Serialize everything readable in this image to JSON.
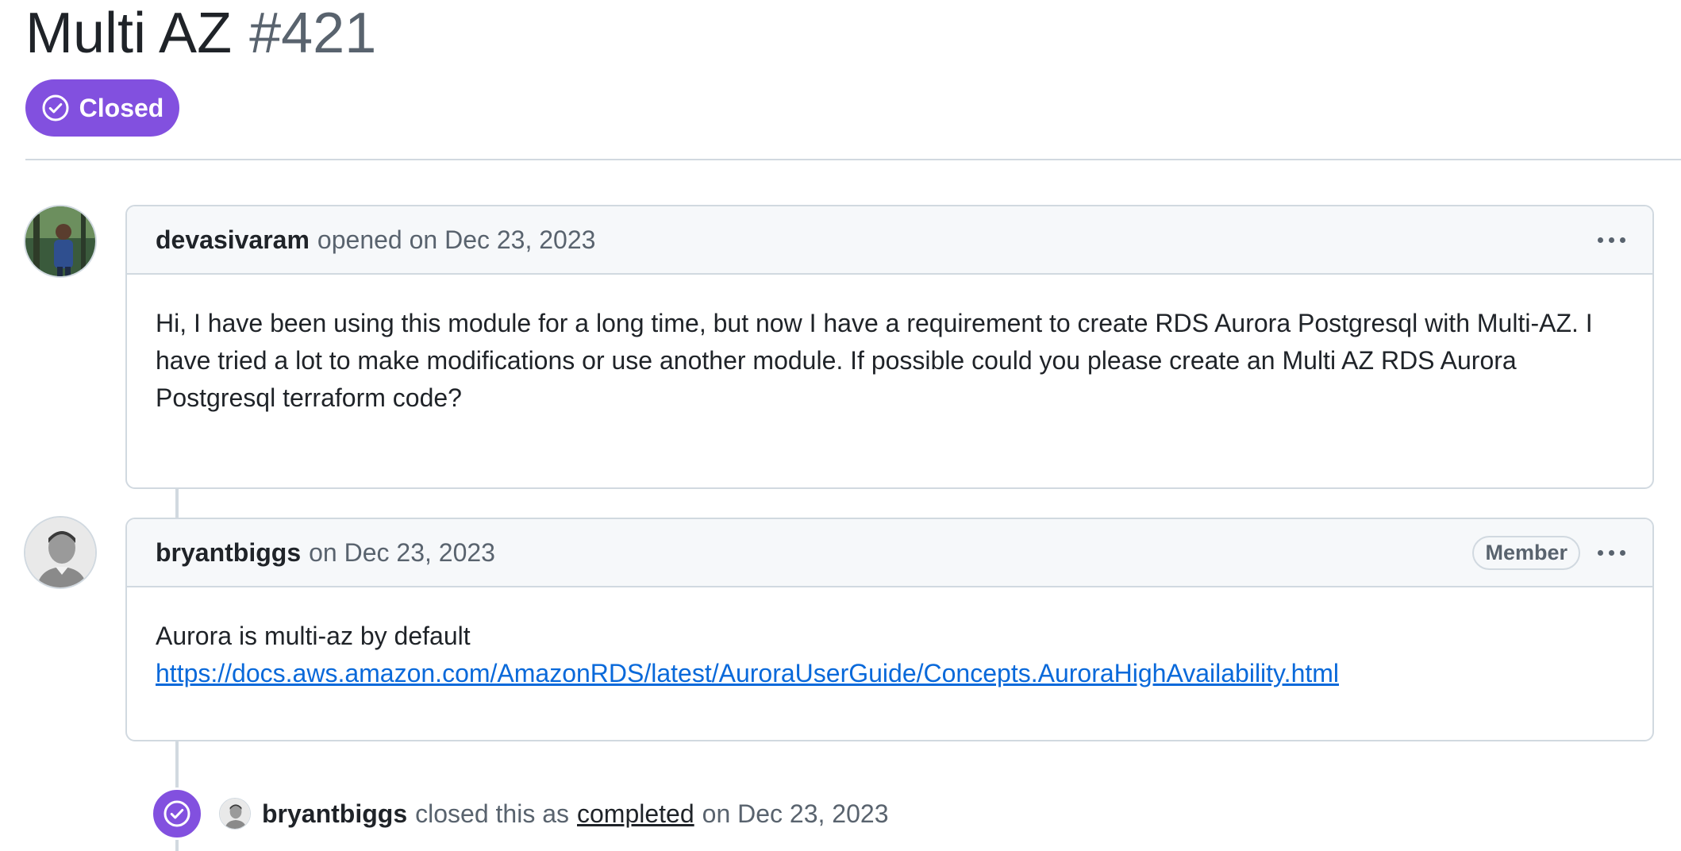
{
  "issue": {
    "title": "Multi AZ",
    "number": "#421",
    "status": "Closed",
    "status_color": "#8250df"
  },
  "comments": [
    {
      "author": "devasivaram",
      "meta": "opened on Dec 23, 2023",
      "body": "Hi, I have been using this module for a long time, but now I have a requirement to create RDS Aurora Postgresql with Multi-AZ. I have tried a lot to make modifications or use another module. If possible could you please create an Multi AZ RDS Aurora Postgresql terraform code?"
    },
    {
      "author": "bryantbiggs",
      "meta": "on Dec 23, 2023",
      "role": "Member",
      "body_text": "Aurora is multi-az by default",
      "body_link": "https://docs.aws.amazon.com/AmazonRDS/latest/AuroraUserGuide/Concepts.AuroraHighAvailability.html"
    }
  ],
  "event": {
    "author": "bryantbiggs",
    "action": "closed this as",
    "reason": "completed",
    "date": "on Dec 23, 2023",
    "icon": "check-circle-icon"
  }
}
